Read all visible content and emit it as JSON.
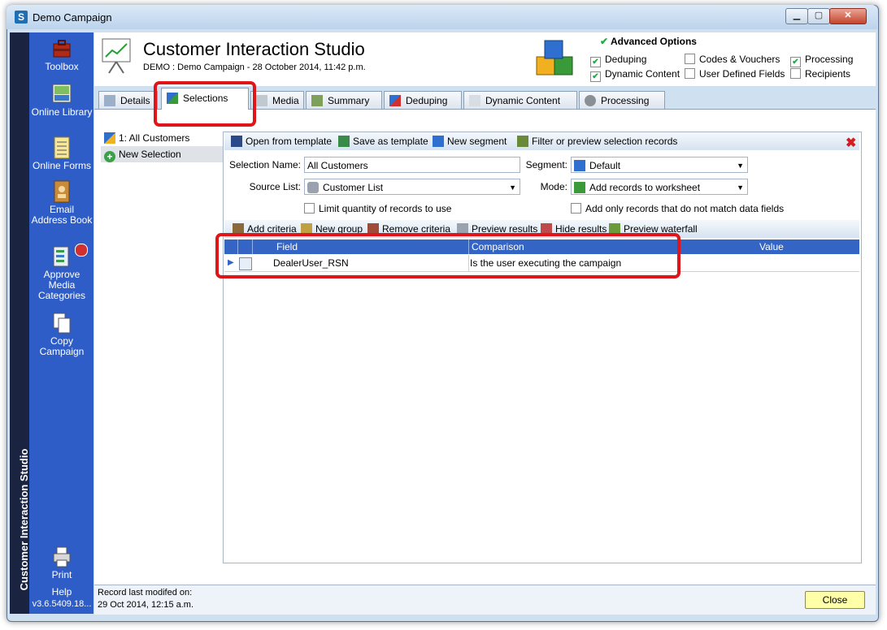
{
  "window": {
    "title": "Demo Campaign",
    "icon_letter": "S"
  },
  "sidebar": {
    "vertical_title": "Customer Interaction Studio",
    "items": [
      {
        "label": "Toolbox"
      },
      {
        "label": "Online Library"
      },
      {
        "label": "Online Forms"
      },
      {
        "label": "Email Address Book"
      },
      {
        "label": "Approve Media Categories"
      },
      {
        "label": "Copy Campaign"
      }
    ],
    "print_label": "Print",
    "help_label": "Help",
    "version": "v3.6.5409.18..."
  },
  "header": {
    "title": "Customer Interaction Studio",
    "subtitle": "DEMO : Demo Campaign - 28 October 2014, 11:42 p.m."
  },
  "advanced": {
    "title": "Advanced Options",
    "options": [
      {
        "label": "Deduping",
        "checked": true
      },
      {
        "label": "Codes & Vouchers",
        "checked": false
      },
      {
        "label": "Processing",
        "checked": true
      },
      {
        "label": "Dynamic Content",
        "checked": true
      },
      {
        "label": "User Defined Fields",
        "checked": false
      },
      {
        "label": "Recipients",
        "checked": false
      }
    ]
  },
  "tabs": [
    {
      "label": "Details"
    },
    {
      "label": "Selections"
    },
    {
      "label": "Media"
    },
    {
      "label": "Summary"
    },
    {
      "label": "Deduping"
    },
    {
      "label": "Dynamic Content"
    },
    {
      "label": "Processing"
    }
  ],
  "selections_list": [
    {
      "label": "1: All Customers"
    },
    {
      "label": "New Selection"
    }
  ],
  "toolbar": {
    "open_template": "Open from template",
    "save_template": "Save as template",
    "new_segment": "New segment",
    "filter_preview": "Filter or preview selection records",
    "close_mark": "✖"
  },
  "form": {
    "selection_name_label": "Selection Name:",
    "selection_name_value": "All Customers",
    "segment_label": "Segment:",
    "segment_value": "Default",
    "source_list_label": "Source List:",
    "source_list_value": "Customer List",
    "mode_label": "Mode:",
    "mode_value": "Add records to worksheet",
    "limit_label": "Limit quantity of records to use",
    "add_only_label": "Add only records that do not match data fields"
  },
  "criteria_toolbar": {
    "add": "Add criteria",
    "new_group": "New group",
    "remove": "Remove criteria",
    "preview": "Preview results",
    "hide": "Hide results",
    "waterfall": "Preview waterfall"
  },
  "grid": {
    "columns": [
      "Field",
      "Comparison",
      "Value"
    ],
    "rows": [
      {
        "field": "DealerUser_RSN",
        "comparison": "Is the user executing the campaign",
        "value": ""
      }
    ]
  },
  "status": {
    "label": "Record last modifed on:",
    "date": "29 Oct 2014, 12:15 a.m.",
    "close_button": "Close"
  }
}
